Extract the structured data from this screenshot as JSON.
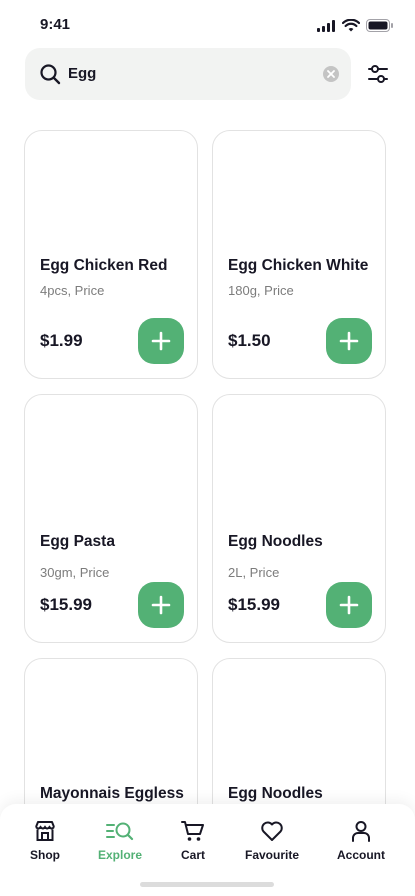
{
  "status": {
    "time": "9:41"
  },
  "search": {
    "value": "Egg"
  },
  "products": [
    {
      "name": "Egg Chicken Red",
      "unit": "4pcs, Price",
      "price": "$1.99"
    },
    {
      "name": "Egg Chicken White",
      "unit": "180g, Price",
      "price": "$1.50"
    },
    {
      "name": "Egg Pasta",
      "unit": "30gm, Price",
      "price": "$15.99"
    },
    {
      "name": "Egg Noodles",
      "unit": "2L, Price",
      "price": "$15.99"
    },
    {
      "name": "Mayonnais Eggless",
      "unit": "",
      "price": ""
    },
    {
      "name": "Egg Noodles",
      "unit": "",
      "price": ""
    }
  ],
  "tabs": [
    {
      "label": "Shop",
      "icon": "shop-icon"
    },
    {
      "label": "Explore",
      "icon": "explore-icon"
    },
    {
      "label": "Cart",
      "icon": "cart-icon"
    },
    {
      "label": "Favourite",
      "icon": "heart-icon"
    },
    {
      "label": "Account",
      "icon": "account-icon"
    }
  ],
  "active_tab": "Explore",
  "colors": {
    "accent": "#53B175",
    "text": "#181725",
    "muted": "#7C7C7C",
    "search_bg": "#F2F3F2",
    "card_border": "#E2E2E2"
  }
}
